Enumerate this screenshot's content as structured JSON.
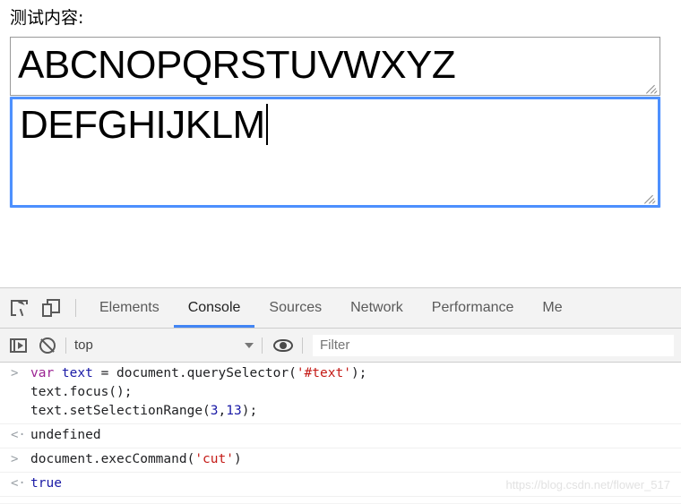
{
  "page": {
    "label": "测试内容:",
    "textarea_one": {
      "value": "ABCNOPQRSTUVWXYZ",
      "focused": false,
      "resize_grip": "resize-grip-icon"
    },
    "textarea_two": {
      "value": "DEFGHIJKLM",
      "focused": true,
      "caret_after": "M",
      "resize_grip": "resize-grip-icon"
    },
    "focus_border_color": "#4d90fe",
    "idle_border_color": "#9a9a9a"
  },
  "devtools": {
    "toolbar_icons": [
      {
        "name": "inspect-element-icon",
        "title": "Inspect"
      },
      {
        "name": "device-toolbar-icon",
        "title": "Toggle device toolbar"
      }
    ],
    "tabs": [
      {
        "label": "Elements",
        "active": false
      },
      {
        "label": "Console",
        "active": true
      },
      {
        "label": "Sources",
        "active": false
      },
      {
        "label": "Network",
        "active": false
      },
      {
        "label": "Performance",
        "active": false
      },
      {
        "label": "Me",
        "active": false
      }
    ],
    "active_tab_underline_color": "#4285f4",
    "console_toolbar": {
      "sidebar_icon": "sidebar-toggle-icon",
      "clear_icon": "clear-console-icon",
      "context_value": "top",
      "chevron_icon": "chevron-down-icon",
      "eye_icon": "live-expression-eye-icon",
      "filter_placeholder": "Filter"
    },
    "messages": [
      {
        "kind": "input",
        "gutter": ">",
        "lines": [
          [
            {
              "t": "var ",
              "c": "tok-kw"
            },
            {
              "t": "text ",
              "c": "tok-var"
            },
            {
              "t": "= document.querySelector(",
              "c": "tok-plain"
            },
            {
              "t": "'#text'",
              "c": "tok-str"
            },
            {
              "t": ");",
              "c": "tok-plain"
            }
          ],
          [
            {
              "t": "text.focus();",
              "c": "tok-plain"
            }
          ],
          [
            {
              "t": "text.setSelectionRange(",
              "c": "tok-plain"
            },
            {
              "t": "3",
              "c": "tok-num"
            },
            {
              "t": ",",
              "c": "tok-plain"
            },
            {
              "t": "13",
              "c": "tok-num"
            },
            {
              "t": ");",
              "c": "tok-plain"
            }
          ]
        ]
      },
      {
        "kind": "output",
        "gutter": "<·",
        "lines": [
          [
            {
              "t": "undefined",
              "c": "tok-plain"
            }
          ]
        ]
      },
      {
        "kind": "input",
        "gutter": ">",
        "lines": [
          [
            {
              "t": "document.execCommand(",
              "c": "tok-plain"
            },
            {
              "t": "'cut'",
              "c": "tok-str"
            },
            {
              "t": ")",
              "c": "tok-plain"
            }
          ]
        ]
      },
      {
        "kind": "output",
        "gutter": "<·",
        "lines": [
          [
            {
              "t": "true",
              "c": "tok-bool"
            }
          ]
        ]
      }
    ]
  },
  "watermark": "https://blog.csdn.net/flower_517"
}
